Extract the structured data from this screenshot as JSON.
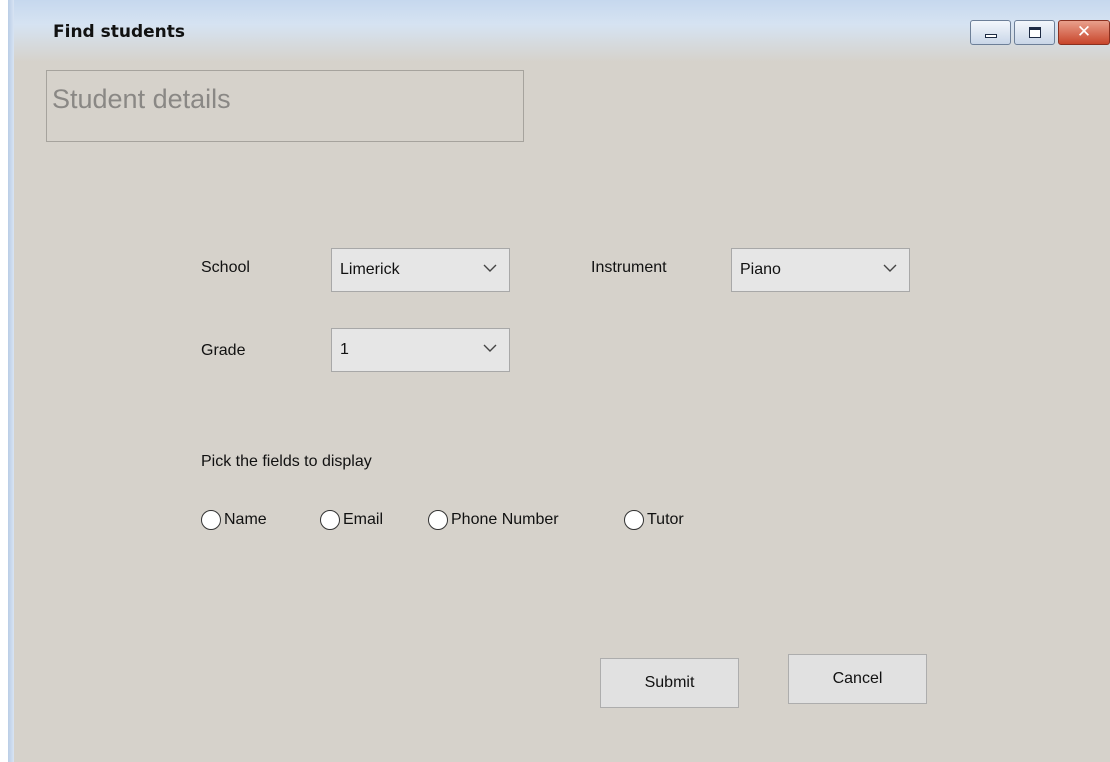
{
  "window": {
    "title": "Find students",
    "controls": {
      "minimize_icon": "minimize-icon",
      "maximize_icon": "maximize-icon",
      "close_icon": "close-icon",
      "close_glyph": "✕"
    }
  },
  "header": {
    "title": "Student details"
  },
  "form": {
    "school": {
      "label": "School",
      "value": "Limerick"
    },
    "instrument": {
      "label": "Instrument",
      "value": "Piano"
    },
    "grade": {
      "label": "Grade",
      "value": "1"
    }
  },
  "fields": {
    "prompt": "Pick the fields to display",
    "options": [
      {
        "label": "Name",
        "selected": false
      },
      {
        "label": "Email",
        "selected": false
      },
      {
        "label": "Phone Number",
        "selected": false
      },
      {
        "label": "Tutor",
        "selected": false
      }
    ]
  },
  "actions": {
    "submit_label": "Submit",
    "cancel_label": "Cancel"
  },
  "colors": {
    "window_bg": "#d6d2cb",
    "title_gradient_top": "#c6d8ee",
    "close_button": "#c8452b"
  }
}
